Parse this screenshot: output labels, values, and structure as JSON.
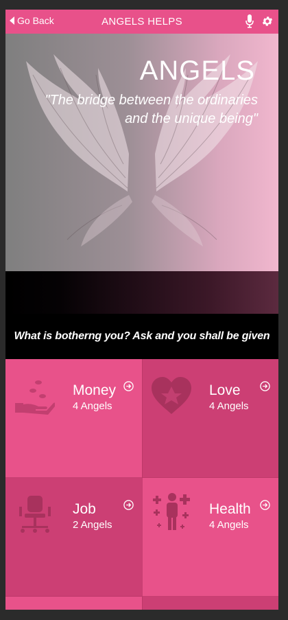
{
  "topbar": {
    "back_label": "Go Back",
    "title": "ANGELS HELPS",
    "icons": [
      "mic-icon",
      "gear-icon"
    ]
  },
  "hero": {
    "title": "ANGELS",
    "quote": "\"The bridge between the ordinaries and the unique being\""
  },
  "prompt": "What is botherng you? Ask and you shall be given",
  "categories": [
    {
      "name": "Money",
      "count": "4 Angels",
      "icon": "money-hand-icon"
    },
    {
      "name": "Love",
      "count": "4 Angels",
      "icon": "heart-icon"
    },
    {
      "name": "Job",
      "count": "2 Angels",
      "icon": "office-chair-icon"
    },
    {
      "name": "Health",
      "count": "4 Angels",
      "icon": "health-person-icon"
    }
  ],
  "colors": {
    "accent": "#e8518a",
    "tile_dark": "#cc3f74",
    "tile_light": "#e8528a"
  }
}
